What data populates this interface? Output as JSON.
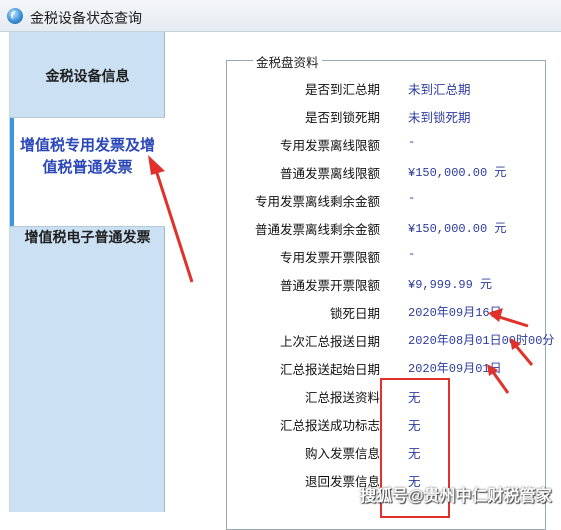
{
  "window": {
    "title": "金税设备状态查询"
  },
  "sidebar": {
    "items": [
      {
        "label": "金税设备信息"
      },
      {
        "label_line1": "增值税专用发票及增",
        "label_line2": "值税普通发票"
      },
      {
        "label": "增值税电子普通发票"
      }
    ]
  },
  "group": {
    "legend": "金税盘资料",
    "rows": [
      {
        "key": "是否到汇总期",
        "value": "未到汇总期"
      },
      {
        "key": "是否到锁死期",
        "value": "未到锁死期"
      },
      {
        "key": "专用发票离线限额",
        "value": "-"
      },
      {
        "key": "普通发票离线限额",
        "value": "¥150,000.00 元"
      },
      {
        "key": "专用发票离线剩余金额",
        "value": "-"
      },
      {
        "key": "普通发票离线剩余金额",
        "value": "¥150,000.00 元"
      },
      {
        "key": "专用发票开票限额",
        "value": "-"
      },
      {
        "key": "普通发票开票限额",
        "value": "¥9,999.99 元"
      },
      {
        "key": "锁死日期",
        "value": "2020年09月16日"
      },
      {
        "key": "上次汇总报送日期",
        "value": "2020年08月01日00时00分"
      },
      {
        "key": "汇总报送起始日期",
        "value": "2020年09月01日"
      },
      {
        "key": "汇总报送资料",
        "value": "无"
      },
      {
        "key": "汇总报送成功标志",
        "value": "无"
      },
      {
        "key": "购入发票信息",
        "value": "无"
      },
      {
        "key": "退回发票信息",
        "value": "无"
      }
    ]
  },
  "watermark": "搜狐号@贵州中仁财税管家",
  "colors": {
    "accent": "#2b47b8",
    "annotation": "#e0322b",
    "sidebar_bg": "#cbe0f2"
  }
}
